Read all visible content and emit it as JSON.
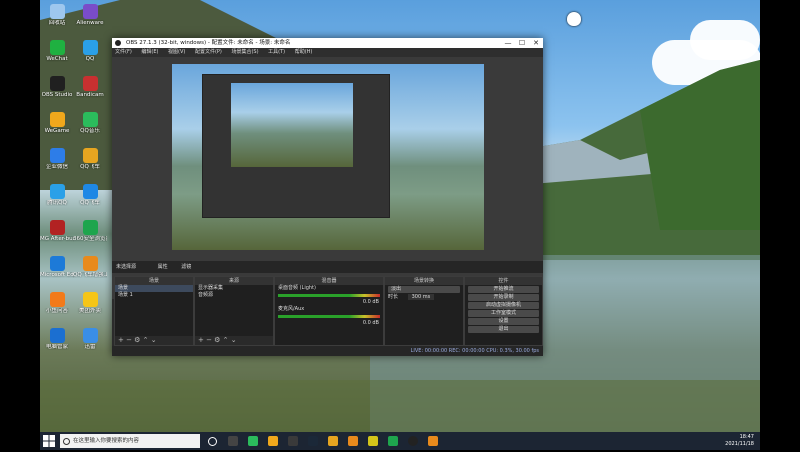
{
  "desktop": {
    "icons": [
      {
        "label": "回收站",
        "color": "#9ec7ee"
      },
      {
        "label": "Alienware",
        "color": "#7a4cc9"
      },
      {
        "label": "WeChat",
        "color": "#1fb141"
      },
      {
        "label": "QQ",
        "color": "#2aa0e8"
      },
      {
        "label": "OBS Studio",
        "color": "#202020"
      },
      {
        "label": "Bandicam",
        "color": "#c83030"
      },
      {
        "label": "WeGame",
        "color": "#f0a81c"
      },
      {
        "label": "QQ音乐",
        "color": "#2bbc5c"
      },
      {
        "label": "企业微信",
        "color": "#2d7de8"
      },
      {
        "label": "QQ飞车",
        "color": "#e6a520"
      },
      {
        "label": "腾讯QQ",
        "color": "#2aa0e8"
      },
      {
        "label": "QQ飞车",
        "color": "#1e88e5"
      },
      {
        "label": "MG After-burner",
        "color": "#b22222"
      },
      {
        "label": "360安全浏览器",
        "color": "#1ea54d"
      },
      {
        "label": "Microsoft Edge",
        "color": "#1d7ad8"
      },
      {
        "label": "QQ飞车增强工具",
        "color": "#e88a1c"
      },
      {
        "label": "小鱼问答",
        "color": "#f27a1a"
      },
      {
        "label": "美团外卖",
        "color": "#f5c518"
      },
      {
        "label": "电脑管家",
        "color": "#1b6fd1"
      },
      {
        "label": "迅雷",
        "color": "#3a8ee6"
      }
    ]
  },
  "obs": {
    "title": "OBS 27.1.3 (32-bit, windows) - 配置文件: 未命名 - 场景: 未命名",
    "menu": [
      "文件(F)",
      "编辑(E)",
      "视图(V)",
      "配置文件(P)",
      "场景集合(S)",
      "工具(T)",
      "帮助(H)"
    ],
    "window_buttons": {
      "min": "—",
      "max": "☐",
      "close": "✕"
    },
    "scene_tabs": {
      "source_selected": "未选择源",
      "props": "属性",
      "filters": "滤镜"
    },
    "docks": {
      "scenes": {
        "title": "场景",
        "items": [
          "场景",
          "场景 1"
        ]
      },
      "sources": {
        "title": "来源",
        "items": [
          "显示器采集",
          "音频源"
        ]
      },
      "mixer": {
        "title": "混音器",
        "tracks": [
          {
            "name": "桌面音频 (Light)",
            "level": "0.0 dB"
          },
          {
            "name": "麦克风/Aux",
            "level": "0.0 dB"
          }
        ]
      },
      "transitions": {
        "title": "场景转换",
        "type": "淡出",
        "duration_label": "时长",
        "duration": "300 ms"
      },
      "controls": {
        "title": "控件",
        "buttons": [
          "开始推流",
          "开始录制",
          "启动虚拟摄像机",
          "工作室模式",
          "设置",
          "退出"
        ]
      }
    },
    "status": "LIVE: 00:00:00   REC: 00:00:00   CPU: 0.3%, 30.00 fps"
  },
  "taskbar": {
    "search_placeholder": "在这里输入你要搜索的内容",
    "time": "18:47",
    "date": "2021/11/18"
  }
}
